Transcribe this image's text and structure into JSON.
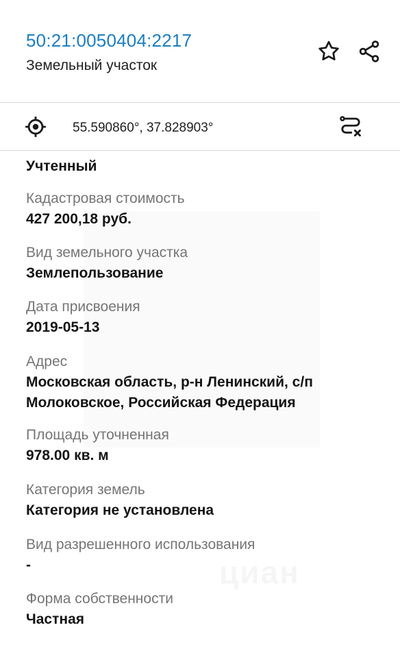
{
  "header": {
    "cadastral_number": "50:21:0050404:2217",
    "object_type": "Земельный участок",
    "favorite_icon": "star-icon",
    "share_icon": "share-icon"
  },
  "coordinates": {
    "locate_icon": "crosshair-icon",
    "text": "55.590860°, 37.828903°",
    "route_icon": "route-icon"
  },
  "properties": [
    {
      "label": "",
      "value": "Учтенный"
    },
    {
      "label": "Кадастровая стоимость",
      "value": "427 200,18 руб."
    },
    {
      "label": "Вид земельного участка",
      "value": "Землепользование"
    },
    {
      "label": "Дата присвоения",
      "value": "2019-05-13"
    },
    {
      "label": "Адрес",
      "value": "Московская область, р-н Ленинский, с/п Молоковское, Российская Федерация"
    },
    {
      "label": "Площадь уточненная",
      "value": "978.00 кв. м"
    },
    {
      "label": "Категория земель",
      "value": "Категория не установлена"
    },
    {
      "label": "Вид разрешенного использования",
      "value": "-"
    },
    {
      "label": "Форма собственности",
      "value": "Частная"
    }
  ],
  "colors": {
    "accent": "#1b7ec2",
    "label": "#757575",
    "value": "#141414",
    "divider": "#d6d6d6"
  },
  "watermark": "циан"
}
